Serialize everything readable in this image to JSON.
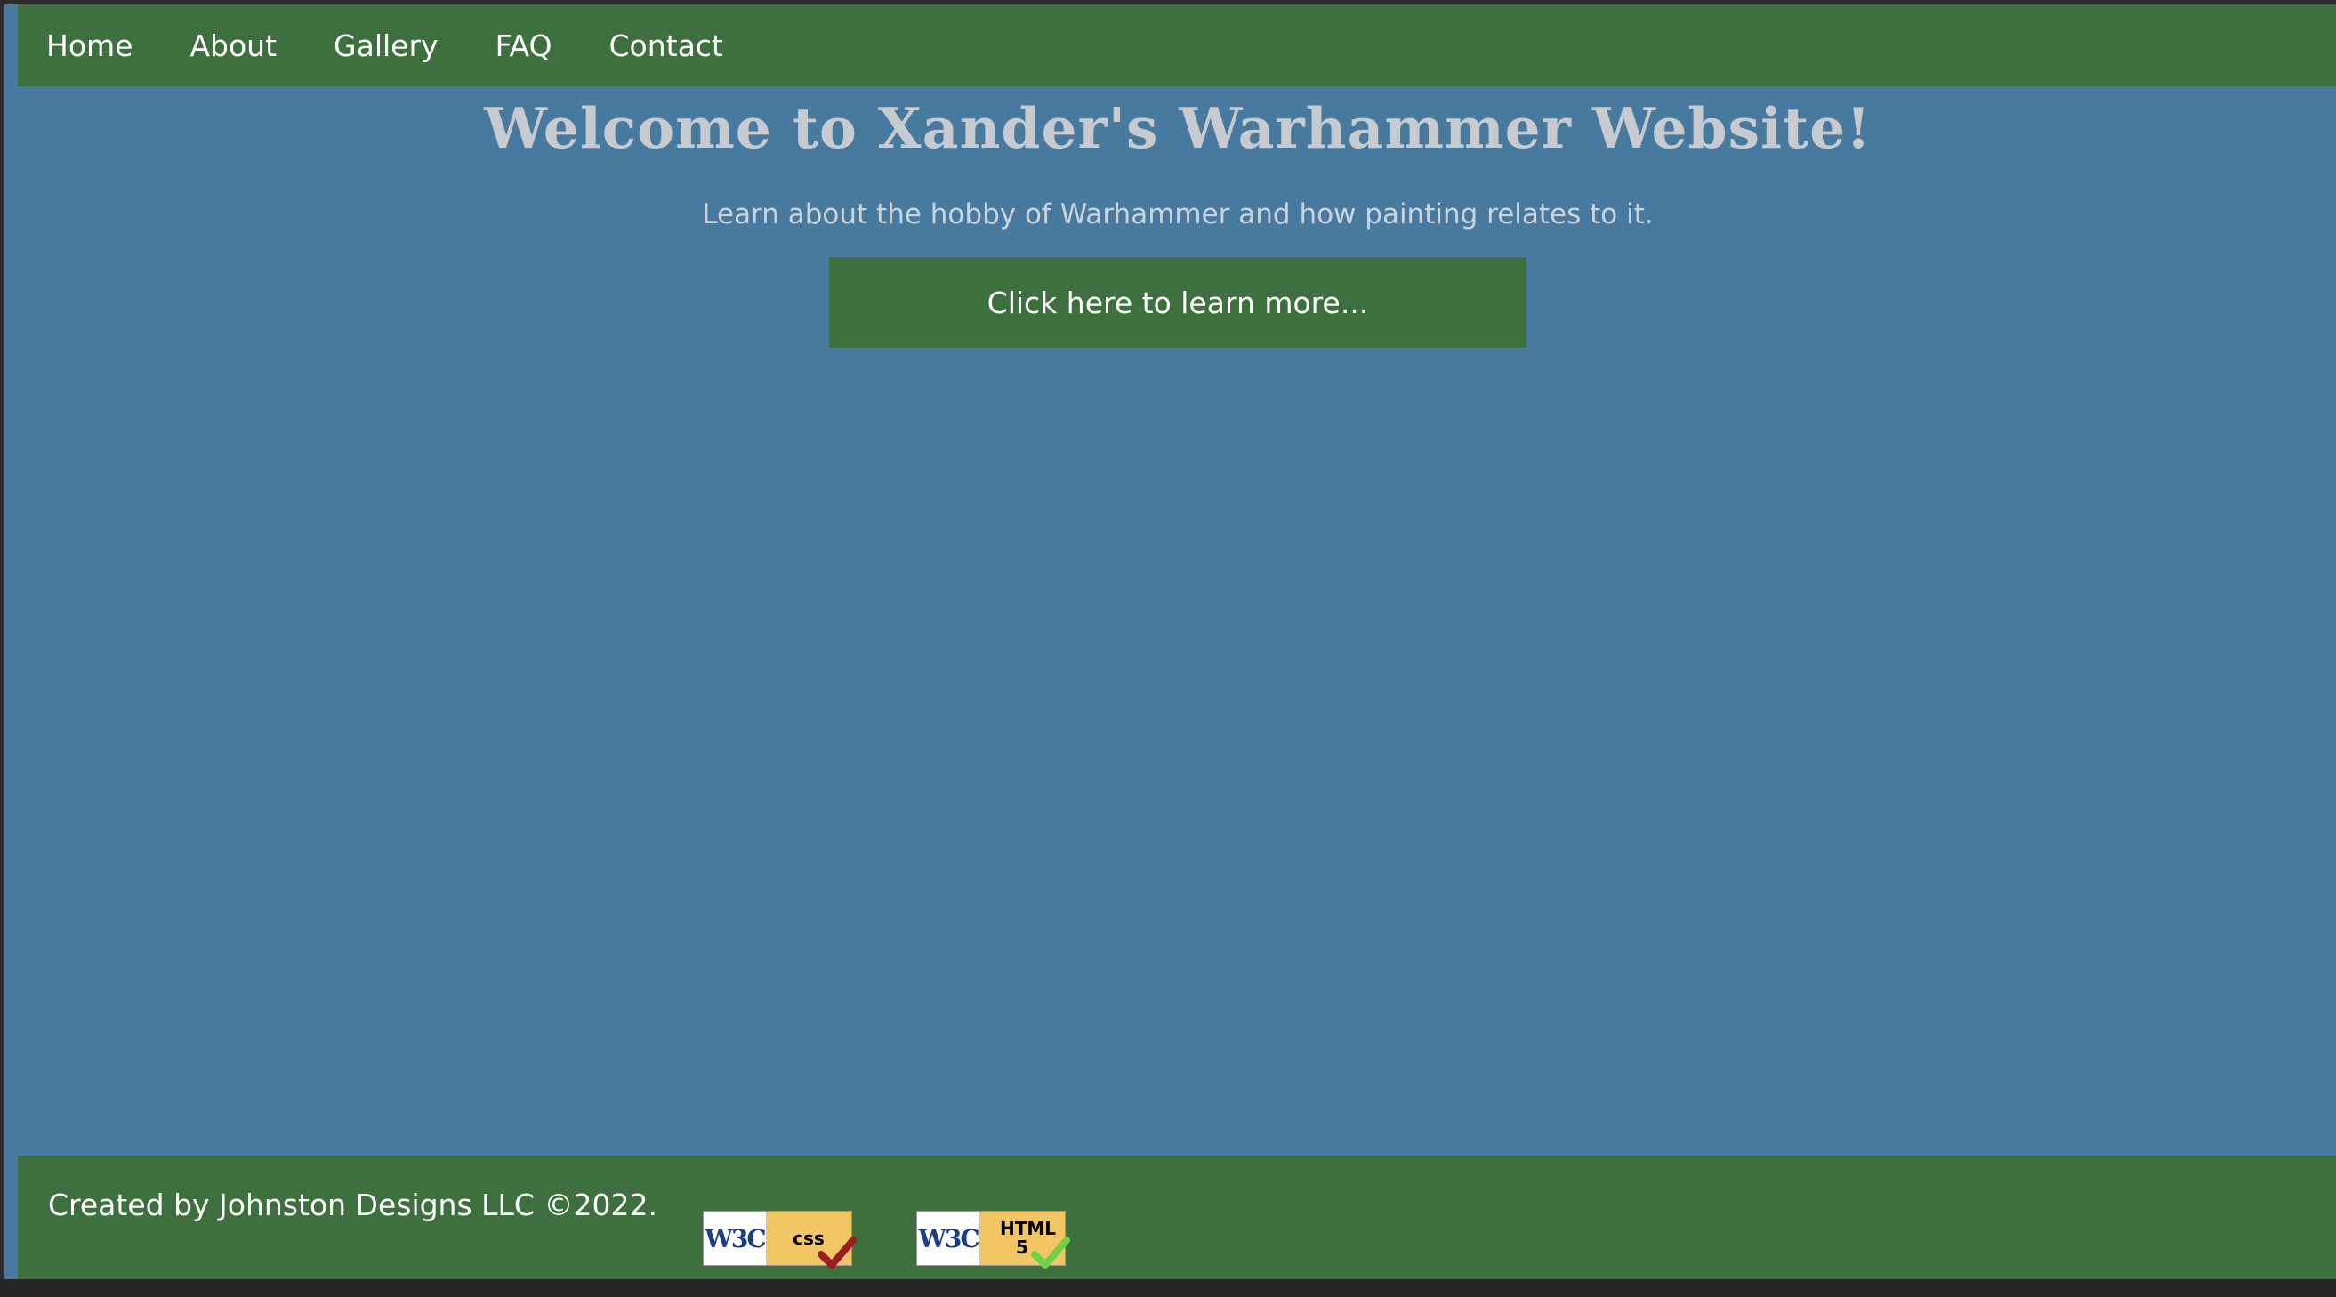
{
  "nav": {
    "items": [
      {
        "label": "Home"
      },
      {
        "label": "About"
      },
      {
        "label": "Gallery"
      },
      {
        "label": "FAQ"
      },
      {
        "label": "Contact"
      }
    ]
  },
  "hero": {
    "title": "Welcome to Xander's Warhammer Website!",
    "subtitle": "Learn about the hobby of Warhammer and how painting relates to it.",
    "cta_label": "Click here to learn more..."
  },
  "footer": {
    "credit": "Created by Johnston Designs LLC ©2022.",
    "badges": [
      {
        "w3c": "W3C",
        "tech": "css",
        "check_color": "#9a1e1e",
        "icon": "checkmark-icon"
      },
      {
        "w3c": "W3C",
        "tech": "HTML 5",
        "check_color": "#6fd04a",
        "icon": "checkmark-icon"
      }
    ]
  },
  "colors": {
    "background": "#477a9e",
    "bars": "#3e6f3e",
    "title": "#c7cbd0",
    "link_text": "#ffffff"
  }
}
